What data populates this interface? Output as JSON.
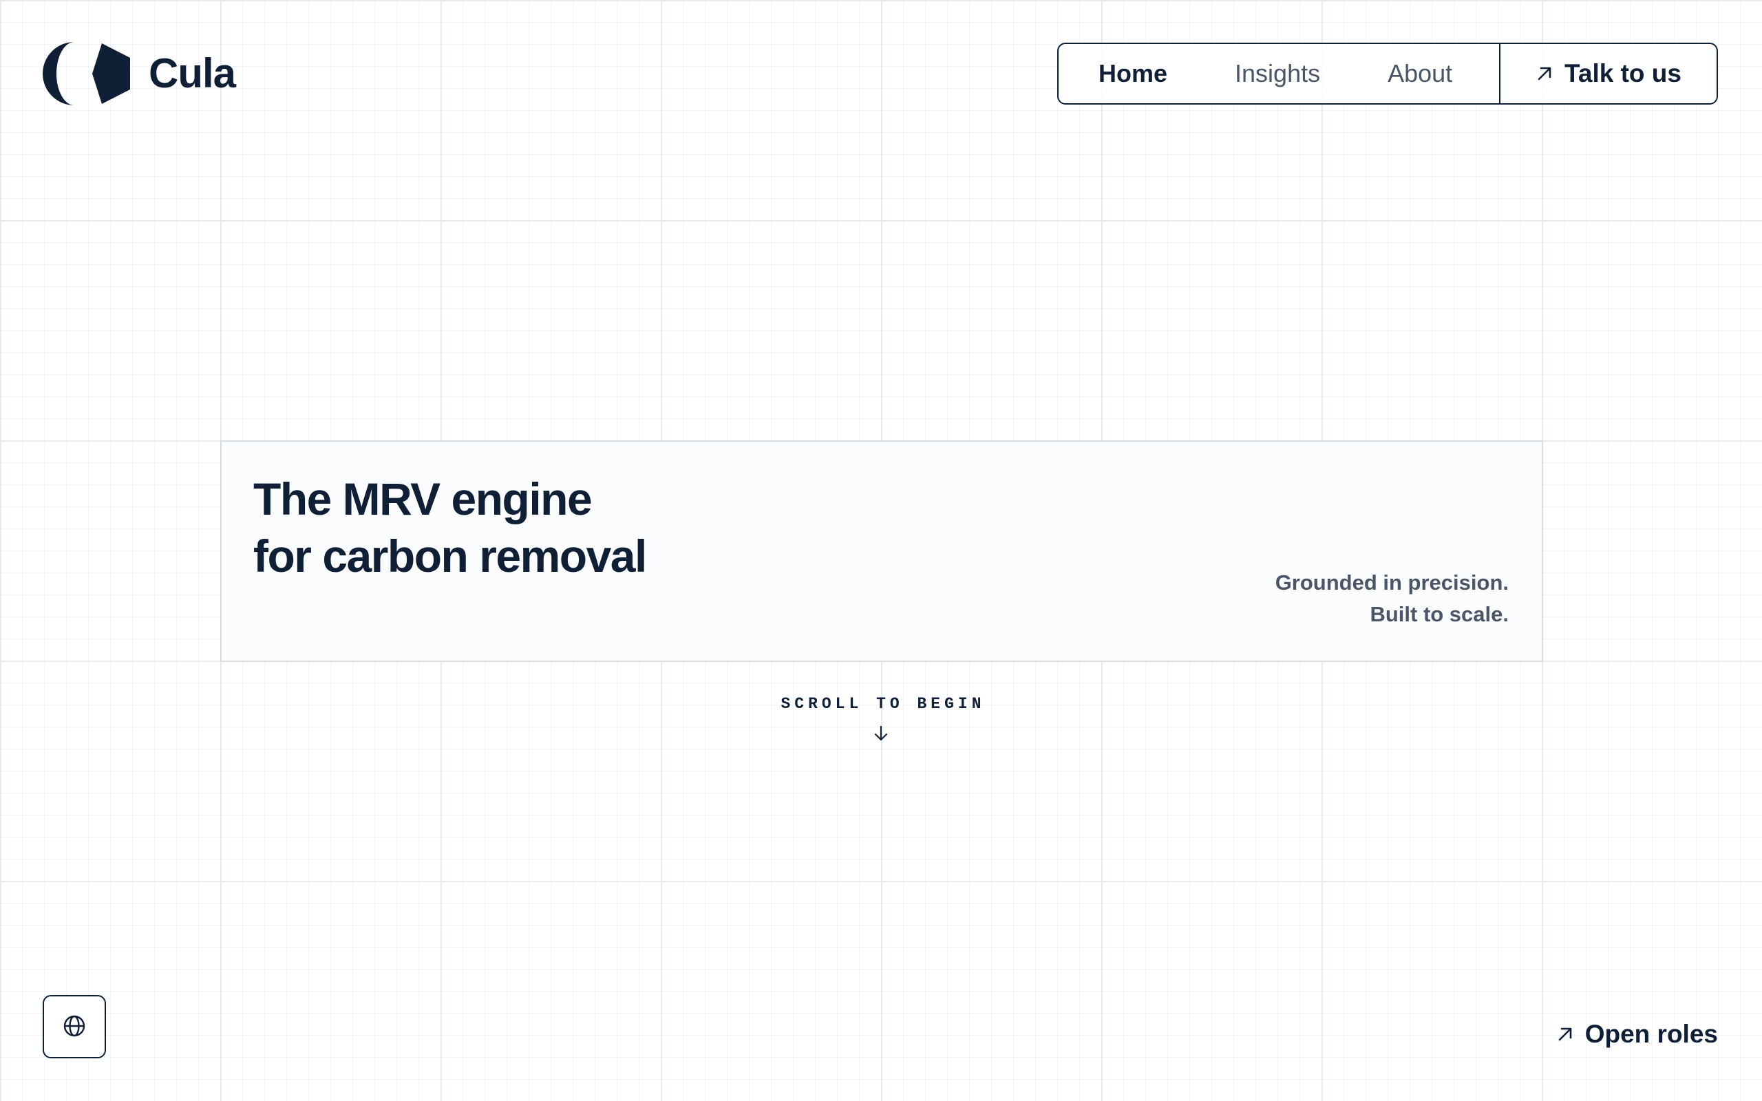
{
  "brand": {
    "name": "Cula",
    "logo_icon": "cula-logo-icon",
    "color": "#0f1f36"
  },
  "nav": {
    "links": [
      {
        "label": "Home",
        "active": true
      },
      {
        "label": "Insights",
        "active": false
      },
      {
        "label": "About",
        "active": false
      }
    ],
    "cta": {
      "label": "Talk to us",
      "icon": "arrow-up-right-icon"
    }
  },
  "hero": {
    "title_line_1": "The MRV engine",
    "title_line_2": "for carbon removal",
    "tagline_line_1": "Grounded in precision.",
    "tagline_line_2": "Built to scale."
  },
  "scroll": {
    "label": "SCROLL TO BEGIN",
    "icon": "arrow-down-icon"
  },
  "footer": {
    "language_icon": "globe-icon",
    "open_roles": {
      "label": "Open roles",
      "icon": "arrow-up-right-icon"
    }
  },
  "colors": {
    "text_primary": "#0f1f36",
    "text_secondary": "#4a5668",
    "grid_major": "#e4eaee",
    "grid_minor": "#f2f5f7",
    "card_border": "#d5dde3"
  }
}
